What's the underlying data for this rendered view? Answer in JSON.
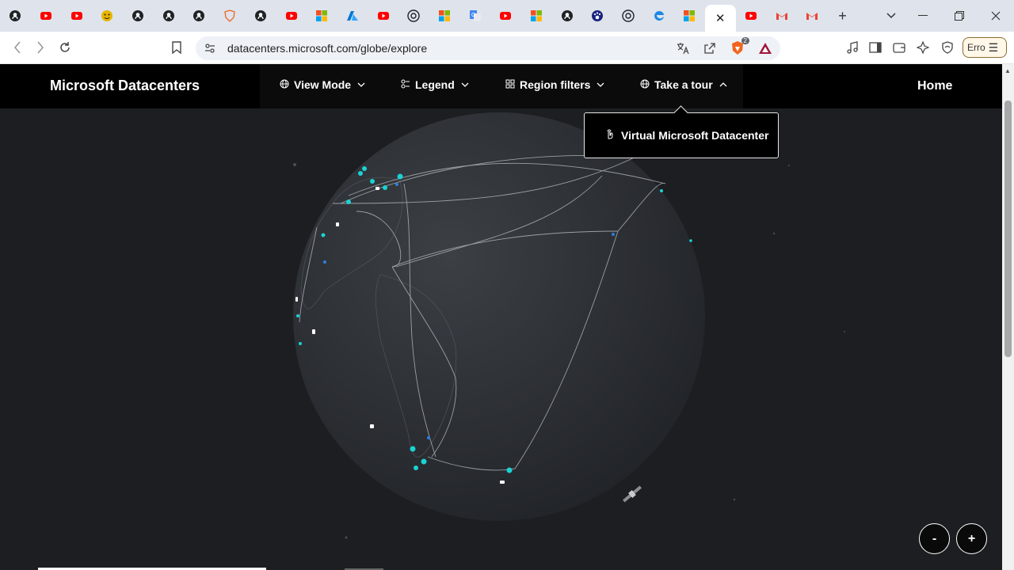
{
  "browser": {
    "tabs": [
      {
        "icon": "github-icon",
        "color": "#1f2328"
      },
      {
        "icon": "youtube-icon",
        "color": "#ff0000"
      },
      {
        "icon": "youtube-icon",
        "color": "#ff0000"
      },
      {
        "icon": "emoji-icon",
        "color": "#e8b400"
      },
      {
        "icon": "github-icon",
        "color": "#1f2328"
      },
      {
        "icon": "github-icon",
        "color": "#1f2328"
      },
      {
        "icon": "github-icon",
        "color": "#1f2328"
      },
      {
        "icon": "brave-shield-icon",
        "color": "#f0651d"
      },
      {
        "icon": "github-icon",
        "color": "#1f2328"
      },
      {
        "icon": "youtube-icon",
        "color": "#ff0000"
      },
      {
        "icon": "microsoft-icon",
        "color": "#f25022"
      },
      {
        "icon": "azure-icon",
        "color": "#0078d4"
      },
      {
        "icon": "youtube-icon",
        "color": "#ff0000"
      },
      {
        "icon": "openai-icon",
        "color": "#1f2328"
      },
      {
        "icon": "microsoft-icon",
        "color": "#f25022"
      },
      {
        "icon": "translate-icon",
        "color": "#4285f4"
      },
      {
        "icon": "youtube-icon",
        "color": "#ff0000"
      },
      {
        "icon": "microsoft-icon",
        "color": "#f25022"
      },
      {
        "icon": "github-icon",
        "color": "#1f2328"
      },
      {
        "icon": "paw-icon",
        "color": "#1a237e"
      },
      {
        "icon": "openai-icon",
        "color": "#1f2328"
      },
      {
        "icon": "edge-icon",
        "color": "#1e88e5"
      },
      {
        "icon": "microsoft-icon",
        "color": "#f25022"
      },
      {
        "icon": "close-icon",
        "color": "#222222",
        "active": true
      },
      {
        "icon": "youtube-icon",
        "color": "#ff0000"
      },
      {
        "icon": "gmail-icon",
        "color": "#ea4335"
      },
      {
        "icon": "gmail-icon",
        "color": "#ea4335"
      }
    ],
    "address_bar": {
      "url": "datacenters.microsoft.com/globe/explore"
    },
    "shields_count": "2",
    "profile_button_label": "Erro"
  },
  "site": {
    "brand": "Microsoft Datacenters",
    "menu": [
      {
        "label": "View Mode",
        "icon": "globe-icon"
      },
      {
        "label": "Legend",
        "icon": "legend-icon"
      },
      {
        "label": "Region filters",
        "icon": "filter-icon"
      },
      {
        "label": "Take a tour",
        "icon": "globe-icon"
      }
    ],
    "home_label": "Home",
    "tour_dropdown": {
      "item_label": "Virtual Microsoft Datacenter",
      "item_icon": "hand-point-icon"
    },
    "zoom_out_label": "-",
    "zoom_in_label": "+"
  },
  "colors": {
    "background": "#1c1e21",
    "globe": "#2a2d31",
    "datacenter_marker": "#19d3d3",
    "nav_background": "#000000"
  }
}
